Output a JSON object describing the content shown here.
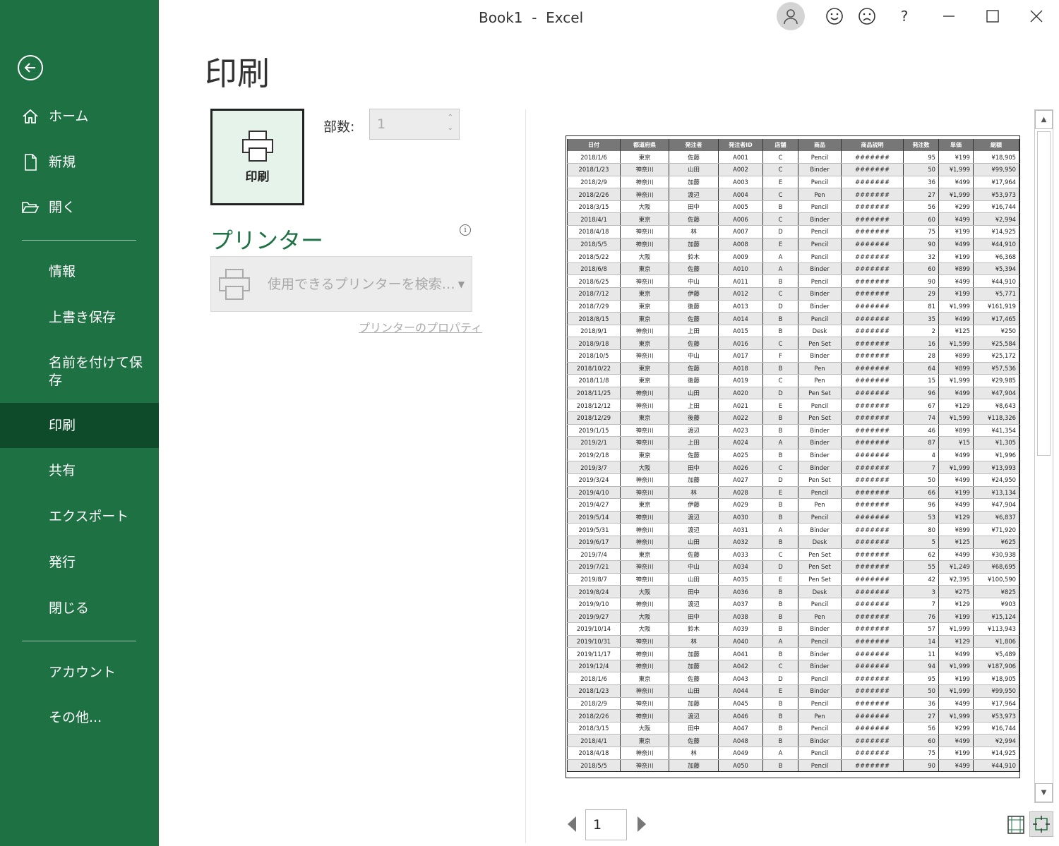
{
  "window": {
    "title": "Book1  -  Excel",
    "minimize": "minimize-icon",
    "maximize": "maximize-icon",
    "close": "close-icon"
  },
  "titlebar_icons": [
    "account-icon",
    "smile-icon",
    "frown-icon",
    "help-icon"
  ],
  "titlebar_help": "?",
  "sidebar": {
    "bg_color": "#1e7143",
    "active_color": "#0e4b2a",
    "items": [
      {
        "label": "ホーム",
        "icon": "home-icon"
      },
      {
        "label": "新規",
        "icon": "new-document-icon"
      },
      {
        "label": "開く",
        "icon": "folder-open-icon"
      },
      {
        "label": "情報"
      },
      {
        "label": "上書き保存"
      },
      {
        "label": "名前を付けて保存"
      },
      {
        "label": "印刷",
        "active": true
      },
      {
        "label": "共有"
      },
      {
        "label": "エクスポート"
      },
      {
        "label": "発行"
      },
      {
        "label": "閉じる"
      },
      {
        "label": "アカウント"
      },
      {
        "label": "その他..."
      }
    ]
  },
  "print": {
    "heading": "印刷",
    "print_button": "印刷",
    "copies_label": "部数:",
    "copies_value": "1",
    "printer_heading": "プリンター",
    "printer_placeholder": "使用できるプリンターを検索…",
    "printer_properties": "プリンターのプロパティ",
    "accent_color": "#1e7143"
  },
  "preview": {
    "headers": [
      "日付",
      "都道府県",
      "発注者",
      "発注者ID",
      "店舗",
      "商品",
      "商品説明",
      "発注数",
      "単価",
      "総額"
    ],
    "rows": [
      [
        "2018/1/6",
        "東京",
        "佐藤",
        "A001",
        "C",
        "Pencil",
        "#######",
        "95",
        "¥199",
        "¥18,905"
      ],
      [
        "2018/1/23",
        "神奈川",
        "山田",
        "A002",
        "C",
        "Binder",
        "#######",
        "50",
        "¥1,999",
        "¥99,950"
      ],
      [
        "2018/2/9",
        "神奈川",
        "加藤",
        "A003",
        "E",
        "Pencil",
        "#######",
        "36",
        "¥499",
        "¥17,964"
      ],
      [
        "2018/2/26",
        "神奈川",
        "渡辺",
        "A004",
        "C",
        "Pen",
        "#######",
        "27",
        "¥1,999",
        "¥53,973"
      ],
      [
        "2018/3/15",
        "大阪",
        "田中",
        "A005",
        "B",
        "Pencil",
        "#######",
        "56",
        "¥299",
        "¥16,744"
      ],
      [
        "2018/4/1",
        "東京",
        "佐藤",
        "A006",
        "C",
        "Binder",
        "#######",
        "60",
        "¥499",
        "¥2,994"
      ],
      [
        "2018/4/18",
        "神奈川",
        "林",
        "A007",
        "D",
        "Pencil",
        "#######",
        "75",
        "¥199",
        "¥14,925"
      ],
      [
        "2018/5/5",
        "神奈川",
        "加藤",
        "A008",
        "E",
        "Pencil",
        "#######",
        "90",
        "¥499",
        "¥44,910"
      ],
      [
        "2018/5/22",
        "大阪",
        "鈴木",
        "A009",
        "A",
        "Pencil",
        "#######",
        "32",
        "¥199",
        "¥6,368"
      ],
      [
        "2018/6/8",
        "東京",
        "佐藤",
        "A010",
        "A",
        "Binder",
        "#######",
        "60",
        "¥899",
        "¥5,394"
      ],
      [
        "2018/6/25",
        "神奈川",
        "中山",
        "A011",
        "B",
        "Pencil",
        "#######",
        "90",
        "¥499",
        "¥44,910"
      ],
      [
        "2018/7/12",
        "東京",
        "伊藤",
        "A012",
        "C",
        "Binder",
        "#######",
        "29",
        "¥199",
        "¥5,771"
      ],
      [
        "2018/7/29",
        "東京",
        "後藤",
        "A013",
        "D",
        "Binder",
        "#######",
        "81",
        "¥1,999",
        "¥161,919"
      ],
      [
        "2018/8/15",
        "東京",
        "佐藤",
        "A014",
        "B",
        "Pencil",
        "#######",
        "35",
        "¥499",
        "¥17,465"
      ],
      [
        "2018/9/1",
        "神奈川",
        "上田",
        "A015",
        "B",
        "Desk",
        "#######",
        "2",
        "¥125",
        "¥250"
      ],
      [
        "2018/9/18",
        "東京",
        "佐藤",
        "A016",
        "C",
        "Pen Set",
        "#######",
        "16",
        "¥1,599",
        "¥25,584"
      ],
      [
        "2018/10/5",
        "神奈川",
        "中山",
        "A017",
        "F",
        "Binder",
        "#######",
        "28",
        "¥899",
        "¥25,172"
      ],
      [
        "2018/10/22",
        "東京",
        "佐藤",
        "A018",
        "B",
        "Pen",
        "#######",
        "64",
        "¥899",
        "¥57,536"
      ],
      [
        "2018/11/8",
        "東京",
        "後藤",
        "A019",
        "C",
        "Pen",
        "#######",
        "15",
        "¥1,999",
        "¥29,985"
      ],
      [
        "2018/11/25",
        "神奈川",
        "山田",
        "A020",
        "D",
        "Pen Set",
        "#######",
        "96",
        "¥499",
        "¥47,904"
      ],
      [
        "2018/12/12",
        "神奈川",
        "上田",
        "A021",
        "E",
        "Pencil",
        "#######",
        "67",
        "¥129",
        "¥8,643"
      ],
      [
        "2018/12/29",
        "東京",
        "後藤",
        "A022",
        "B",
        "Pen Set",
        "#######",
        "74",
        "¥1,599",
        "¥118,326"
      ],
      [
        "2019/1/15",
        "神奈川",
        "渡辺",
        "A023",
        "B",
        "Binder",
        "#######",
        "46",
        "¥899",
        "¥41,354"
      ],
      [
        "2019/2/1",
        "神奈川",
        "上田",
        "A024",
        "A",
        "Binder",
        "#######",
        "87",
        "¥15",
        "¥1,305"
      ],
      [
        "2019/2/18",
        "東京",
        "佐藤",
        "A025",
        "B",
        "Binder",
        "#######",
        "4",
        "¥499",
        "¥1,996"
      ],
      [
        "2019/3/7",
        "大阪",
        "田中",
        "A026",
        "C",
        "Binder",
        "#######",
        "7",
        "¥1,999",
        "¥13,993"
      ],
      [
        "2019/3/24",
        "神奈川",
        "加藤",
        "A027",
        "D",
        "Pen Set",
        "#######",
        "50",
        "¥499",
        "¥24,950"
      ],
      [
        "2019/4/10",
        "神奈川",
        "林",
        "A028",
        "E",
        "Pencil",
        "#######",
        "66",
        "¥199",
        "¥13,134"
      ],
      [
        "2019/4/27",
        "東京",
        "伊藤",
        "A029",
        "B",
        "Pen",
        "#######",
        "96",
        "¥499",
        "¥47,904"
      ],
      [
        "2019/5/14",
        "神奈川",
        "渡辺",
        "A030",
        "B",
        "Pencil",
        "#######",
        "53",
        "¥129",
        "¥6,837"
      ],
      [
        "2019/5/31",
        "神奈川",
        "渡辺",
        "A031",
        "A",
        "Binder",
        "#######",
        "80",
        "¥899",
        "¥71,920"
      ],
      [
        "2019/6/17",
        "神奈川",
        "山田",
        "A032",
        "B",
        "Desk",
        "#######",
        "5",
        "¥125",
        "¥625"
      ],
      [
        "2019/7/4",
        "東京",
        "佐藤",
        "A033",
        "C",
        "Pen Set",
        "#######",
        "62",
        "¥499",
        "¥30,938"
      ],
      [
        "2019/7/21",
        "神奈川",
        "中山",
        "A034",
        "D",
        "Pen Set",
        "#######",
        "55",
        "¥1,249",
        "¥68,695"
      ],
      [
        "2019/8/7",
        "神奈川",
        "山田",
        "A035",
        "E",
        "Pen Set",
        "#######",
        "42",
        "¥2,395",
        "¥100,590"
      ],
      [
        "2019/8/24",
        "大阪",
        "田中",
        "A036",
        "B",
        "Desk",
        "#######",
        "3",
        "¥275",
        "¥825"
      ],
      [
        "2019/9/10",
        "神奈川",
        "渡辺",
        "A037",
        "B",
        "Pencil",
        "#######",
        "7",
        "¥129",
        "¥903"
      ],
      [
        "2019/9/27",
        "大阪",
        "田中",
        "A038",
        "B",
        "Pen",
        "#######",
        "76",
        "¥199",
        "¥15,124"
      ],
      [
        "2019/10/14",
        "大阪",
        "鈴木",
        "A039",
        "B",
        "Binder",
        "#######",
        "57",
        "¥1,999",
        "¥113,943"
      ],
      [
        "2019/10/31",
        "神奈川",
        "林",
        "A040",
        "A",
        "Pencil",
        "#######",
        "14",
        "¥129",
        "¥1,806"
      ],
      [
        "2019/11/17",
        "神奈川",
        "加藤",
        "A041",
        "B",
        "Binder",
        "#######",
        "11",
        "¥499",
        "¥5,489"
      ],
      [
        "2019/12/4",
        "神奈川",
        "加藤",
        "A042",
        "C",
        "Binder",
        "#######",
        "94",
        "¥1,999",
        "¥187,906"
      ],
      [
        "2018/1/6",
        "東京",
        "佐藤",
        "A043",
        "D",
        "Pencil",
        "#######",
        "95",
        "¥199",
        "¥18,905"
      ],
      [
        "2018/1/23",
        "神奈川",
        "山田",
        "A044",
        "E",
        "Binder",
        "#######",
        "50",
        "¥1,999",
        "¥99,950"
      ],
      [
        "2018/2/9",
        "神奈川",
        "加藤",
        "A045",
        "B",
        "Pencil",
        "#######",
        "36",
        "¥499",
        "¥17,964"
      ],
      [
        "2018/2/26",
        "神奈川",
        "渡辺",
        "A046",
        "B",
        "Pen",
        "#######",
        "27",
        "¥1,999",
        "¥53,973"
      ],
      [
        "2018/3/15",
        "大阪",
        "田中",
        "A047",
        "B",
        "Pencil",
        "#######",
        "56",
        "¥299",
        "¥16,744"
      ],
      [
        "2018/4/1",
        "東京",
        "佐藤",
        "A048",
        "B",
        "Binder",
        "#######",
        "60",
        "¥499",
        "¥2,994"
      ],
      [
        "2018/4/18",
        "神奈川",
        "林",
        "A049",
        "A",
        "Pencil",
        "#######",
        "75",
        "¥199",
        "¥14,925"
      ],
      [
        "2018/5/5",
        "神奈川",
        "加藤",
        "A050",
        "B",
        "Pencil",
        "#######",
        "90",
        "¥499",
        "¥44,910"
      ]
    ]
  },
  "pager": {
    "current_page": "1"
  }
}
